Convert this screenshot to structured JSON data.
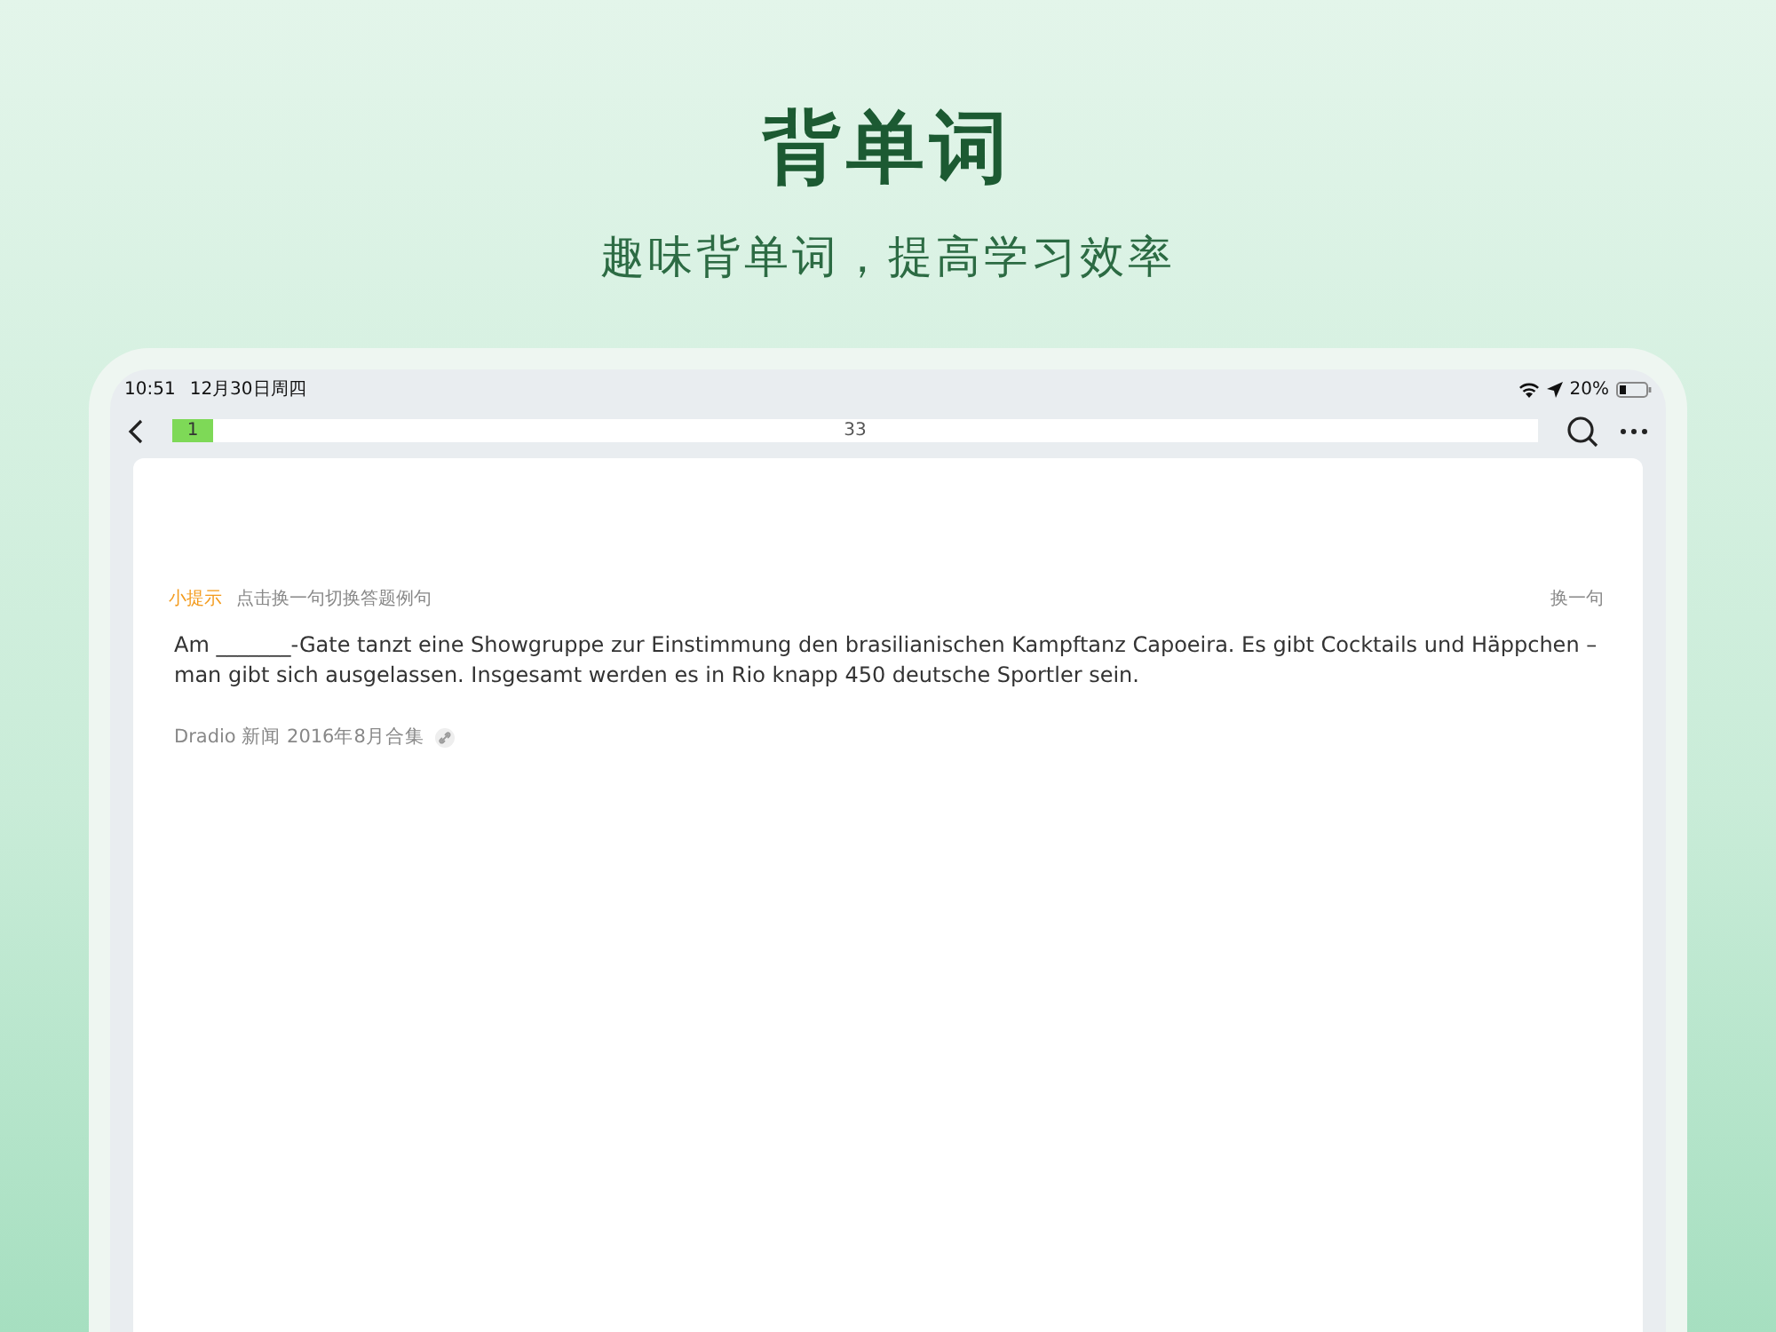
{
  "headline": "背单词",
  "subtitle": "趣味背单词，提高学习效率",
  "status_bar": {
    "time": "10:51",
    "date": "12月30日周四",
    "battery": "20%"
  },
  "progress": {
    "current": "1",
    "total": "33",
    "level": 0.03
  },
  "hint": {
    "label": "小提示",
    "text": "点击换一句切换答题例句",
    "action": "换一句"
  },
  "sentence": "Am _______-Gate tanzt eine Showgruppe zur Einstimmung den brasilianischen Kampftanz Capoeira. Es gibt Cocktails und Häppchen – man gibt sich ausgelassen. Insgesamt werden es in Rio knapp 450 deutsche Sportler sein.",
  "source": "Dradio 新闻 2016年8月合集"
}
